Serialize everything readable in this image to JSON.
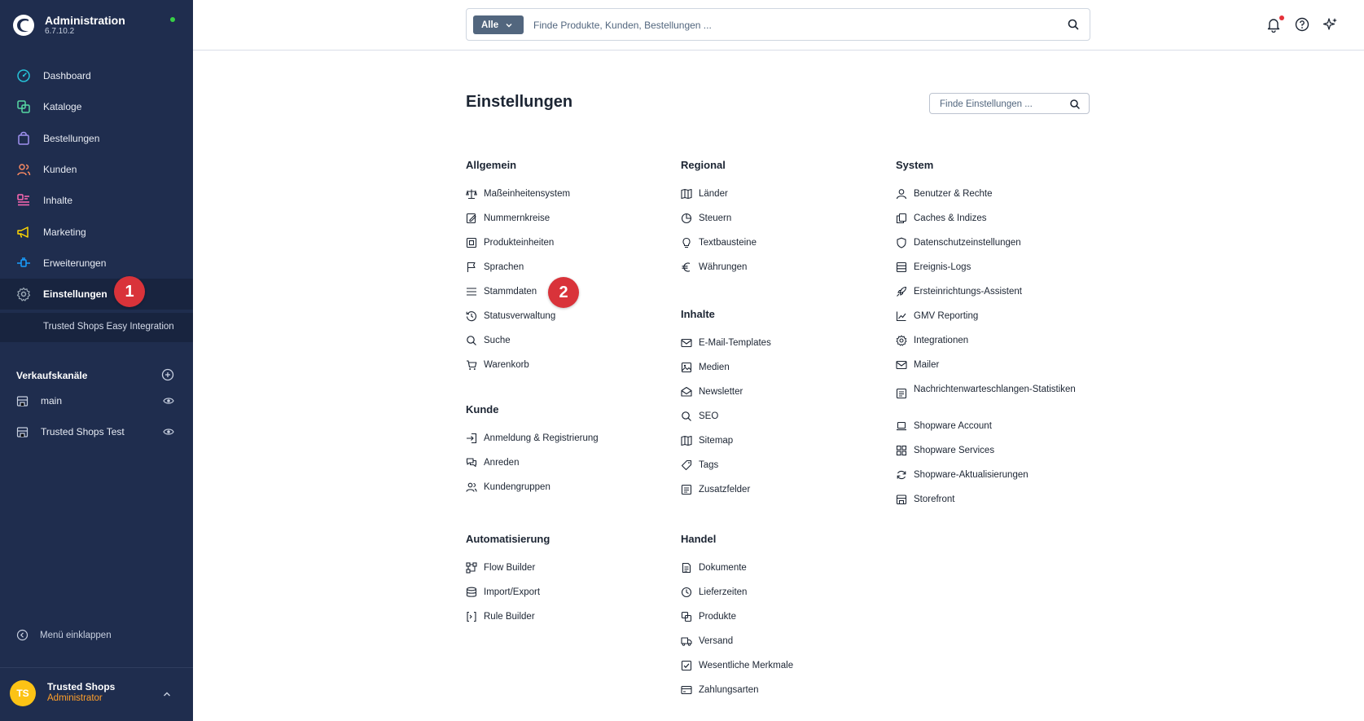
{
  "app": {
    "title": "Administration",
    "version": "6.7.10.2"
  },
  "nav": [
    {
      "label": "Dashboard",
      "icon": "gauge-icon",
      "color": "#26c2d8"
    },
    {
      "label": "Kataloge",
      "icon": "catalog-icon",
      "color": "#57d9a3"
    },
    {
      "label": "Bestellungen",
      "icon": "shopping-bag-icon",
      "color": "#a092f0"
    },
    {
      "label": "Kunden",
      "icon": "users-icon",
      "color": "#f88962"
    },
    {
      "label": "Inhalte",
      "icon": "content-icon",
      "color": "#ff68b4"
    },
    {
      "label": "Marketing",
      "icon": "megaphone-icon",
      "color": "#ffd700"
    },
    {
      "label": "Erweiterungen",
      "icon": "plug-icon",
      "color": "#189eff"
    },
    {
      "label": "Einstellungen",
      "icon": "gear-icon",
      "color": "#9aa8b5"
    }
  ],
  "subnav": {
    "label": "Trusted Shops Easy Integration"
  },
  "badges": {
    "first": "1",
    "second": "2"
  },
  "sales_channels": {
    "title": "Verkaufskanäle",
    "items": [
      {
        "label": "main"
      },
      {
        "label": "Trusted Shops Test"
      }
    ]
  },
  "collapse_label": "Menü einklappen",
  "user": {
    "initials": "TS",
    "name": "Trusted Shops",
    "role": "Administrator"
  },
  "search": {
    "type_label": "Alle",
    "placeholder": "Finde Produkte, Kunden, Bestellungen ..."
  },
  "page_title": "Einstellungen",
  "settings_search": {
    "placeholder": "Finde Einstellungen ..."
  },
  "groups": {
    "allgemein": {
      "title": "Allgemein",
      "items": [
        "Maßeinheitensystem",
        "Nummernkreise",
        "Produkteinheiten",
        "Sprachen",
        "Stammdaten",
        "Statusverwaltung",
        "Suche",
        "Warenkorb"
      ]
    },
    "kunde": {
      "title": "Kunde",
      "items": [
        "Anmeldung & Registrierung",
        "Anreden",
        "Kundengruppen"
      ]
    },
    "automatisierung": {
      "title": "Automatisierung",
      "items": [
        "Flow Builder",
        "Import/Export",
        "Rule Builder"
      ]
    },
    "regional": {
      "title": "Regional",
      "items": [
        "Länder",
        "Steuern",
        "Textbausteine",
        "Währungen"
      ]
    },
    "inhalte": {
      "title": "Inhalte",
      "items": [
        "E-Mail-Templates",
        "Medien",
        "Newsletter",
        "SEO",
        "Sitemap",
        "Tags",
        "Zusatzfelder"
      ]
    },
    "handel": {
      "title": "Handel",
      "items": [
        "Dokumente",
        "Lieferzeiten",
        "Produkte",
        "Versand",
        "Wesentliche Merkmale",
        "Zahlungsarten"
      ]
    },
    "system": {
      "title": "System",
      "items": [
        "Benutzer & Rechte",
        "Caches & Indizes",
        "Datenschutzeinstellungen",
        "Ereignis-Logs",
        "Ersteinrichtungs-Assistent",
        "GMV Reporting",
        "Integrationen",
        "Mailer",
        "Nachrichtenwarteschlangen-Statistiken",
        "Shopware Account",
        "Shopware Services",
        "Shopware-Aktualisierungen",
        "Storefront"
      ]
    }
  }
}
